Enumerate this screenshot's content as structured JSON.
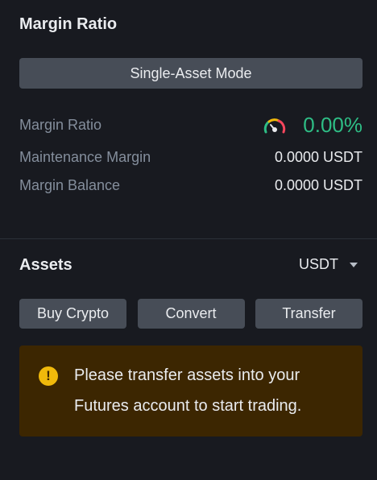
{
  "margin": {
    "title": "Margin Ratio",
    "mode_button": "Single-Asset Mode",
    "ratio_label": "Margin Ratio",
    "ratio_value": "0.00%",
    "maintenance_label": "Maintenance Margin",
    "maintenance_value": "0.0000 USDT",
    "balance_label": "Margin Balance",
    "balance_value": "0.0000 USDT",
    "gauge_icon": "gauge-icon"
  },
  "assets": {
    "title": "Assets",
    "currency": "USDT",
    "buy_label": "Buy Crypto",
    "convert_label": "Convert",
    "transfer_label": "Transfer",
    "notice_text": "Please transfer assets into your Futures account to start trading.",
    "notice_icon": "warning-icon"
  },
  "colors": {
    "background": "#181a20",
    "button": "#474d57",
    "positive": "#2ebd85",
    "notice_bg": "#3c2601",
    "warning": "#f0b90b"
  }
}
